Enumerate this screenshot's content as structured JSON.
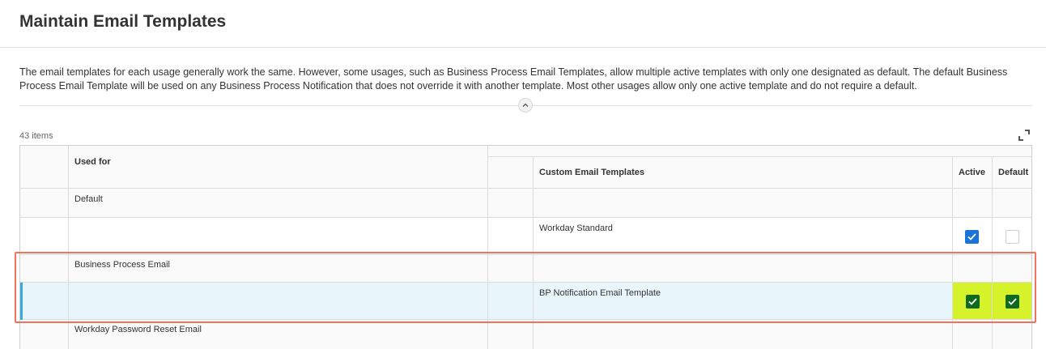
{
  "page": {
    "title": "Maintain Email Templates",
    "description": "The email templates for each usage generally work the same. However, some usages, such as Business Process Email Templates, allow multiple active templates with only one designated as default. The default Business Process Email Template will be used on any Business Process Notification that does not override it with another template. Most other usages allow only one active template and do not require a default."
  },
  "grid": {
    "item_count": "43 items",
    "columns": {
      "used_for": "Used for",
      "custom_templates": "Custom Email Templates",
      "active": "Active",
      "default": "Default"
    },
    "rows": [
      {
        "used_for": "Default",
        "template": "",
        "active": null,
        "default": null
      },
      {
        "used_for": "",
        "template": "Workday Standard",
        "active": true,
        "default": false
      },
      {
        "used_for": "Business Process Email",
        "template": "",
        "active": null,
        "default": null
      },
      {
        "used_for": "",
        "template": "BP Notification Email Template",
        "active": true,
        "default": true,
        "selected": true
      },
      {
        "used_for": "Workday Password Reset Email",
        "template": "",
        "active": null,
        "default": null
      }
    ]
  },
  "colors": {
    "checkbox_checked": "#1a73d9",
    "checkbox_highlighted": "#0f6a1f",
    "highlight_fill": "#d6f22b",
    "annotation_border": "#f0735a",
    "selected_row": "#e8f6fb"
  },
  "icons": [
    "chevron-up-icon",
    "expand-icon",
    "check-icon"
  ]
}
